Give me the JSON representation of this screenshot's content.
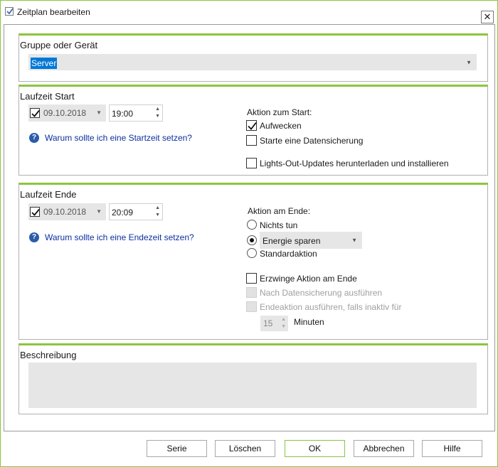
{
  "window": {
    "title": "Zeitplan bearbeiten",
    "close_label": "✕"
  },
  "group_device": {
    "title": "Gruppe oder Gerät",
    "selected": "Server"
  },
  "start": {
    "title": "Laufzeit Start",
    "date": "09.10.2018",
    "date_enabled": true,
    "time": "19:00",
    "help_link": "Warum sollte ich eine Startzeit setzen?",
    "action_title": "Aktion zum Start:",
    "options": [
      {
        "label": "Aufwecken",
        "checked": true
      },
      {
        "label": "Starte eine Datensicherung",
        "checked": false
      },
      {
        "label": "Lights-Out-Updates herunterladen und installieren",
        "checked": false
      }
    ]
  },
  "end": {
    "title": "Laufzeit Ende",
    "date": "09.10.2018",
    "date_enabled": true,
    "time": "20:09",
    "help_link": "Warum sollte ich eine Endezeit setzen?",
    "action_title": "Aktion am Ende:",
    "radio_nothing": "Nichts tun",
    "radio_combo_value": "Energie sparen",
    "radio_standard": "Standardaktion",
    "selected_radio": "combo",
    "force_action": "Erzwinge Aktion am Ende",
    "after_backup": "Nach Datensicherung ausführen",
    "if_inactive": "Endeaktion ausführen, falls inaktiv für",
    "minutes_value": "15",
    "minutes_label": "Minuten"
  },
  "description": {
    "title": "Beschreibung",
    "value": ""
  },
  "buttons": {
    "series": "Serie",
    "delete": "Löschen",
    "ok": "OK",
    "cancel": "Abbrechen",
    "help": "Hilfe"
  },
  "colors": {
    "accent": "#8bc53f",
    "link": "#0b2fa0",
    "selection": "#0078d7"
  },
  "icons": {
    "help": "question-circle-icon",
    "check": "checkmark-icon",
    "dropdown": "chevron-down-icon"
  }
}
